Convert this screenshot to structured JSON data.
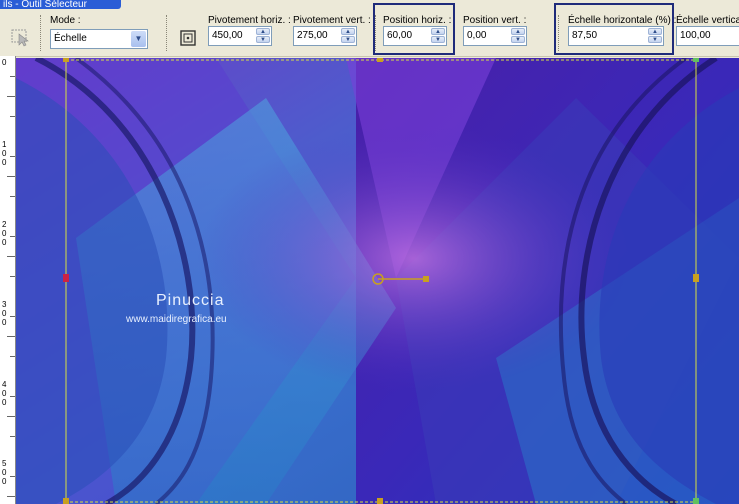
{
  "window": {
    "title": "ils - Outil Sélecteur"
  },
  "toolbar": {
    "mode": {
      "label": "Mode :",
      "value": "Échelle"
    },
    "pivot_h": {
      "label": "Pivotement horiz. :",
      "value": "450,00"
    },
    "pivot_v": {
      "label": "Pivotement vert. :",
      "value": "275,00"
    },
    "pos_h": {
      "label": "Position horiz. :",
      "value": "60,00"
    },
    "pos_v": {
      "label": "Position vert. :",
      "value": "0,00"
    },
    "scale_h": {
      "label": "Échelle horizontale (%) :",
      "value": "87,50"
    },
    "scale_v": {
      "label": "Échelle verticale",
      "value": "100,00"
    }
  },
  "ruler": {
    "labels": [
      "0",
      "100",
      "200",
      "300",
      "400",
      "500"
    ]
  },
  "watermark": {
    "name": "Pinuccia",
    "url": "www.maidiregrafica.eu"
  },
  "colors": {
    "highlight": "#1f2b7a",
    "guide": "#d8e040",
    "handle": "#c8a020",
    "handle_red": "#cc2244"
  }
}
